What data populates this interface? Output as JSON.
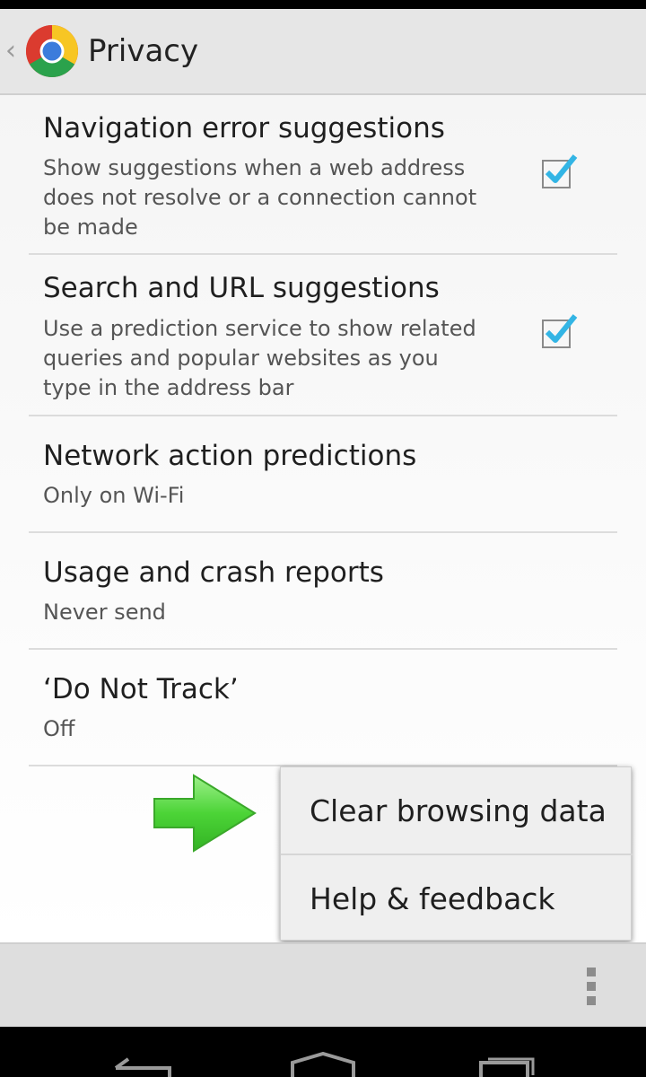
{
  "app": {
    "title": "Privacy"
  },
  "preferences": [
    {
      "title": "Navigation error suggestions",
      "summary": "Show suggestions when a web address\ndoes not resolve or a connection cannot\nbe made",
      "checked": true
    },
    {
      "title": "Search and URL suggestions",
      "summary": "Use a prediction service to show related\nqueries and popular websites as you\ntype in the address bar",
      "checked": true
    },
    {
      "title": "Network action predictions",
      "summary": "Only on Wi-Fi"
    },
    {
      "title": "Usage and crash reports",
      "summary": "Never send"
    },
    {
      "title": "‘Do Not Track’",
      "summary": "Off"
    }
  ],
  "menu": {
    "items": [
      "Clear browsing data",
      "Help & feedback"
    ]
  },
  "colors": {
    "check": "#33b5e5",
    "arrow": "#4cd437"
  }
}
